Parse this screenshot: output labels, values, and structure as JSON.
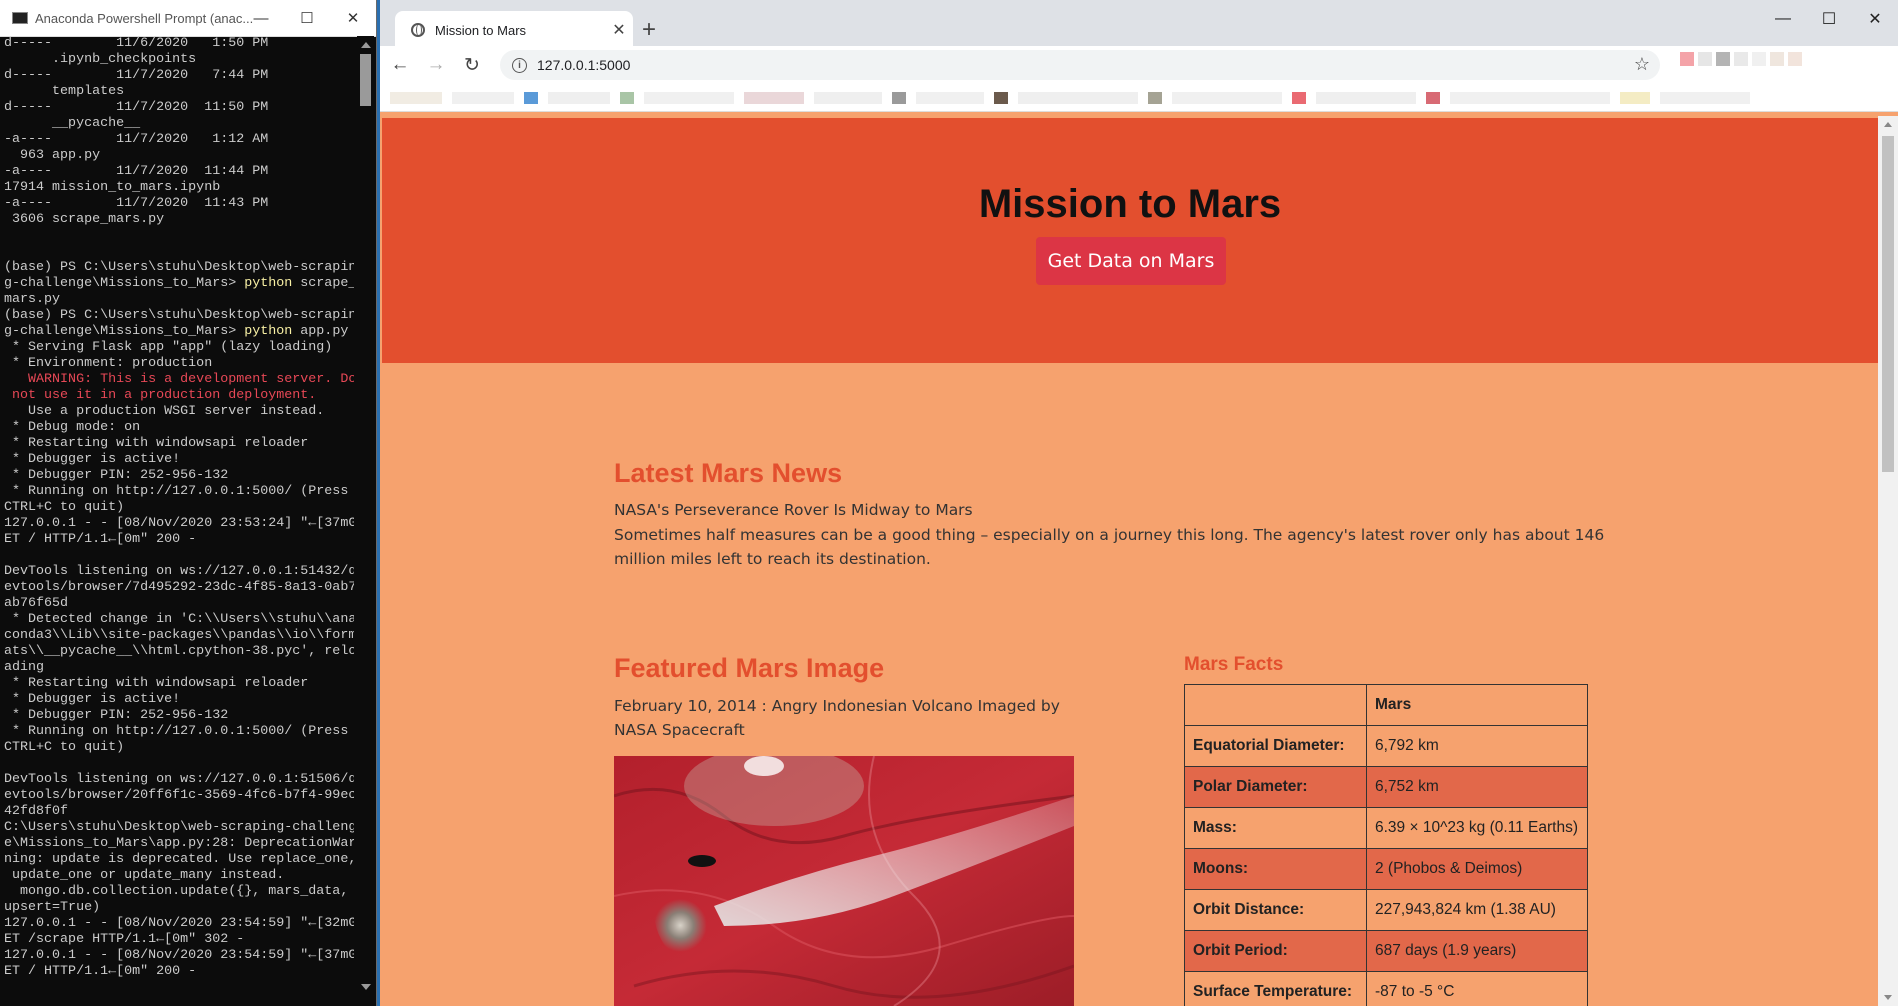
{
  "terminal": {
    "title": "Anaconda Powershell Prompt (anac...",
    "lines": [
      {
        "t": "d-----        11/6/2020   1:50 PM"
      },
      {
        "t": "      .ipynb_checkpoints"
      },
      {
        "t": "d-----        11/7/2020   7:44 PM"
      },
      {
        "t": "      templates"
      },
      {
        "t": "d-----        11/7/2020  11:50 PM"
      },
      {
        "t": "      __pycache__"
      },
      {
        "t": "-a----        11/7/2020   1:12 AM"
      },
      {
        "t": "  963 app.py"
      },
      {
        "t": "-a----        11/7/2020  11:44 PM"
      },
      {
        "t": "17914 mission_to_mars.ipynb"
      },
      {
        "t": "-a----        11/7/2020  11:43 PM"
      },
      {
        "t": " 3606 scrape_mars.py"
      },
      {
        "t": ""
      },
      {
        "t": ""
      },
      {
        "t": "(base) PS C:\\Users\\stuhu\\Desktop\\web-scrapin"
      },
      {
        "t": "g-challenge\\Missions_to_Mars> ",
        "hl": "python",
        "rest": " scrape_"
      },
      {
        "t": "mars.py"
      },
      {
        "t": "(base) PS C:\\Users\\stuhu\\Desktop\\web-scrapin"
      },
      {
        "t": "g-challenge\\Missions_to_Mars> ",
        "hl": "python",
        "rest": " app.py"
      },
      {
        "t": " * Serving Flask app \"app\" (lazy loading)"
      },
      {
        "t": " * Environment: production"
      },
      {
        "t": "   WARNING: This is a development server. Do",
        "c": "r"
      },
      {
        "t": " not use it in a production deployment.",
        "c": "r"
      },
      {
        "t": "   Use a production WSGI server instead."
      },
      {
        "t": " * Debug mode: on"
      },
      {
        "t": " * Restarting with windowsapi reloader"
      },
      {
        "t": " * Debugger is active!"
      },
      {
        "t": " * Debugger PIN: 252-956-132"
      },
      {
        "t": " * Running on http://127.0.0.1:5000/ (Press"
      },
      {
        "t": "CTRL+C to quit)"
      },
      {
        "t": "127.0.0.1 - - [08/Nov/2020 23:53:24] \"←[37mG"
      },
      {
        "t": "ET / HTTP/1.1←[0m\" 200 -"
      },
      {
        "t": ""
      },
      {
        "t": "DevTools listening on ws://127.0.0.1:51432/d"
      },
      {
        "t": "evtools/browser/7d495292-23dc-4f85-8a13-0ab7"
      },
      {
        "t": "ab76f65d"
      },
      {
        "t": " * Detected change in 'C:\\\\Users\\\\stuhu\\\\ana"
      },
      {
        "t": "conda3\\\\Lib\\\\site-packages\\\\pandas\\\\io\\\\form"
      },
      {
        "t": "ats\\\\__pycache__\\\\html.cpython-38.pyc', relo"
      },
      {
        "t": "ading"
      },
      {
        "t": " * Restarting with windowsapi reloader"
      },
      {
        "t": " * Debugger is active!"
      },
      {
        "t": " * Debugger PIN: 252-956-132"
      },
      {
        "t": " * Running on http://127.0.0.1:5000/ (Press"
      },
      {
        "t": "CTRL+C to quit)"
      },
      {
        "t": ""
      },
      {
        "t": "DevTools listening on ws://127.0.0.1:51506/d"
      },
      {
        "t": "evtools/browser/20ff6f1c-3569-4fc6-b7f4-99ec"
      },
      {
        "t": "42fd8f0f"
      },
      {
        "t": "C:\\Users\\stuhu\\Desktop\\web-scraping-challeng"
      },
      {
        "t": "e\\Missions_to_Mars\\app.py:28: DeprecationWar"
      },
      {
        "t": "ning: update is deprecated. Use replace_one,"
      },
      {
        "t": " update_one or update_many instead."
      },
      {
        "t": "  mongo.db.collection.update({}, mars_data,"
      },
      {
        "t": "upsert=True)"
      },
      {
        "t": "127.0.0.1 - - [08/Nov/2020 23:54:59] \"←[32mG"
      },
      {
        "t": "ET /scrape HTTP/1.1←[0m\" 302 -"
      },
      {
        "t": "127.0.0.1 - - [08/Nov/2020 23:54:59] \"←[37mG"
      },
      {
        "t": "ET / HTTP/1.1←[0m\" 200 -"
      }
    ]
  },
  "browser": {
    "tab_title": "Mission to Mars",
    "url": "127.0.0.1:5000"
  },
  "page": {
    "heading": "Mission to Mars",
    "scrape_button": "Get Data on Mars",
    "news": {
      "section_title": "Latest Mars News",
      "title": "NASA's Perseverance Rover Is Midway to Mars",
      "paragraph": "Sometimes half measures can be a good thing – especially on a journey this long. The agency's latest rover only has about 146 million miles left to reach its destination."
    },
    "featured": {
      "section_title": "Featured Mars Image",
      "caption": "February 10, 2014 : Angry Indonesian Volcano Imaged by NASA Spacecraft"
    },
    "facts": {
      "title": "Mars Facts",
      "column_header": "Mars",
      "rows": [
        {
          "k": "Equatorial Diameter:",
          "v": "6,792 km"
        },
        {
          "k": "Polar Diameter:",
          "v": "6,752 km"
        },
        {
          "k": "Mass:",
          "v": "6.39 × 10^23 kg (0.11 Earths)"
        },
        {
          "k": "Moons:",
          "v": "2 (Phobos & Deimos)"
        },
        {
          "k": "Orbit Distance:",
          "v": "227,943,824 km (1.38 AU)"
        },
        {
          "k": "Orbit Period:",
          "v": "687 days (1.9 years)"
        },
        {
          "k": "Surface Temperature:",
          "v": "-87 to -5 °C"
        }
      ]
    }
  },
  "colors": {
    "jumbotron": "#e34f2e",
    "page_bg": "#f6a26e",
    "button": "#dc3545",
    "accent_text": "#e34f2e"
  }
}
